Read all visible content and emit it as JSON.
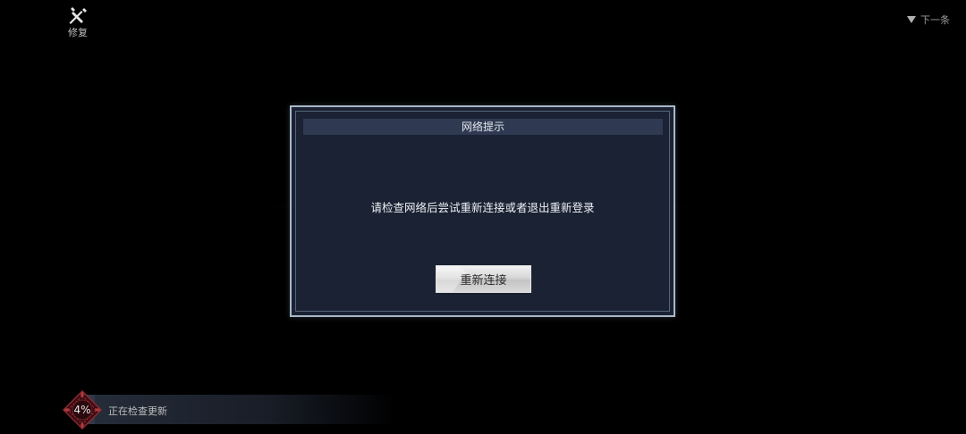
{
  "top_left": {
    "repair_label": "修复"
  },
  "top_right": {
    "next_label": "下一条"
  },
  "dialog": {
    "title": "网络提示",
    "message": "请检查网络后尝试重新连接或者退出重新登录",
    "reconnect_label": "重新连接"
  },
  "progress": {
    "percent_label": "4%",
    "percent": 4,
    "status": "正在检查更新"
  },
  "colors": {
    "background": "#000000",
    "dialog_bg": "#1a2233",
    "dialog_border": "#a9b6c6",
    "title_bar": "#2f3a52",
    "badge_red": "#7a1c22"
  },
  "icons": {
    "repair": "wrench-screwdriver-icon",
    "next": "triangle-down-icon",
    "progress": "ornate-diamond-badge-icon"
  }
}
